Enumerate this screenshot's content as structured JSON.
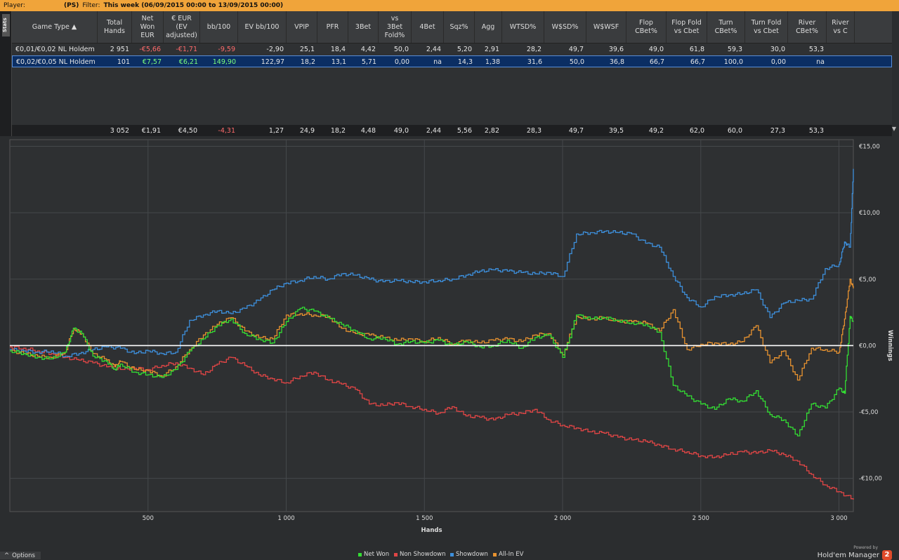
{
  "topbar": {
    "player_label": "Player:",
    "site_tag": "(PS)",
    "filter_label": "Filter:",
    "filter_value": "This week (06/09/2015 00:00 to 13/09/2015 00:00)"
  },
  "sidetab": {
    "label": "Stats"
  },
  "table": {
    "columns": [
      {
        "label": "Game Type ▲",
        "w": 122
      },
      {
        "label": "Total\nHands",
        "w": 49
      },
      {
        "label": "Net\nWon\nEUR",
        "w": 45
      },
      {
        "label": "€ EUR\n(EV\nadjusted)",
        "w": 52
      },
      {
        "label": "bb/100",
        "w": 54
      },
      {
        "label": "EV bb/100",
        "w": 69
      },
      {
        "label": "VPIP",
        "w": 44
      },
      {
        "label": "PFR",
        "w": 44
      },
      {
        "label": "3Bet",
        "w": 43
      },
      {
        "label": "vs\n3Bet\nFold%",
        "w": 47
      },
      {
        "label": "4Bet",
        "w": 46
      },
      {
        "label": "Sqz%",
        "w": 44
      },
      {
        "label": "Agg",
        "w": 39
      },
      {
        "label": "WTSD%",
        "w": 60
      },
      {
        "label": "W$SD%",
        "w": 60
      },
      {
        "label": "W$WSF",
        "w": 57
      },
      {
        "label": "Flop\nCBet%",
        "w": 57
      },
      {
        "label": "Flop Fold\nvs Cbet",
        "w": 58
      },
      {
        "label": "Turn\nCBet%",
        "w": 54
      },
      {
        "label": "Turn Fold\nvs Cbet",
        "w": 61
      },
      {
        "label": "River\nCBet%",
        "w": 55
      },
      {
        "label": "River\nvs C",
        "w": 40
      }
    ],
    "rows": [
      [
        "€0,01/€0,02 NL Holdem",
        "2 951",
        "-€5,66",
        "-€1,71",
        "-9,59",
        "-2,90",
        "25,1",
        "18,4",
        "4,42",
        "50,0",
        "2,44",
        "5,20",
        "2,91",
        "28,2",
        "49,7",
        "39,6",
        "49,0",
        "61,8",
        "59,3",
        "30,0",
        "53,3",
        ""
      ],
      [
        "€0,02/€0,05 NL Holdem",
        "101",
        "€7,57",
        "€6,21",
        "149,90",
        "122,97",
        "18,2",
        "13,1",
        "5,71",
        "0,00",
        "na",
        "14,3",
        "1,38",
        "31,6",
        "50,0",
        "36,8",
        "66,7",
        "66,7",
        "100,0",
        "0,00",
        "na",
        ""
      ]
    ],
    "totals": [
      "",
      "3 052",
      "€1,91",
      "€4,50",
      "-4,31",
      "1,27",
      "24,9",
      "18,2",
      "4,48",
      "49,0",
      "2,44",
      "5,56",
      "2,82",
      "28,3",
      "49,7",
      "39,5",
      "49,2",
      "62,0",
      "60,0",
      "27,3",
      "53,3",
      ""
    ]
  },
  "chart_data": {
    "type": "line",
    "xlabel": "Hands",
    "ylabel": "Winnings",
    "xlim": [
      0,
      3052
    ],
    "ylim": [
      -12.5,
      15.5
    ],
    "x_ticks": [
      500,
      1000,
      1500,
      2000,
      2500,
      3000
    ],
    "x_tick_labels": [
      "500",
      "1 000",
      "1 500",
      "2 000",
      "2 500",
      "3 000"
    ],
    "y_ticks": [
      15,
      10,
      5,
      0,
      -5,
      -10
    ],
    "y_tick_labels": [
      "€15,00",
      "€10,00",
      "€5,00",
      "€0,00",
      "-€5,00",
      "-€10,00"
    ],
    "grid": true,
    "legend_position": "bottom",
    "series": [
      {
        "name": "Net Won",
        "color": "#33dd33",
        "x": [
          0,
          50,
          100,
          150,
          200,
          230,
          260,
          300,
          350,
          380,
          400,
          450,
          500,
          550,
          600,
          650,
          700,
          750,
          800,
          850,
          900,
          950,
          1000,
          1050,
          1100,
          1150,
          1200,
          1250,
          1300,
          1350,
          1400,
          1450,
          1500,
          1550,
          1600,
          1650,
          1700,
          1750,
          1800,
          1850,
          1900,
          1950,
          2000,
          2050,
          2100,
          2150,
          2200,
          2250,
          2300,
          2350,
          2400,
          2450,
          2500,
          2550,
          2600,
          2650,
          2700,
          2750,
          2800,
          2850,
          2900,
          2950,
          3000,
          3020,
          3040,
          3052
        ],
        "y": [
          -0.4,
          -0.6,
          -0.9,
          -1.0,
          -0.5,
          1.3,
          0.9,
          -0.8,
          -1.2,
          -1.8,
          -1.4,
          -2.0,
          -2.2,
          -2.4,
          -1.8,
          -0.4,
          0.5,
          1.5,
          2.0,
          0.9,
          0.5,
          0.2,
          1.8,
          2.8,
          2.6,
          2.1,
          1.6,
          1.1,
          0.5,
          0.6,
          0.1,
          0.3,
          0.2,
          0.4,
          0.0,
          0.3,
          -0.1,
          0.0,
          0.4,
          -0.2,
          0.6,
          0.8,
          -0.9,
          2.3,
          2.0,
          2.1,
          1.9,
          1.7,
          1.6,
          1.0,
          -3.0,
          -3.8,
          -4.4,
          -4.8,
          -4.0,
          -4.2,
          -3.4,
          -5.2,
          -5.6,
          -6.8,
          -4.4,
          -4.7,
          -3.2,
          -3.6,
          2.2,
          1.8
        ]
      },
      {
        "name": "Non Showdown",
        "color": "#e04545",
        "x": [
          0,
          50,
          100,
          150,
          200,
          250,
          300,
          350,
          400,
          450,
          500,
          550,
          600,
          650,
          700,
          750,
          800,
          850,
          900,
          950,
          1000,
          1050,
          1100,
          1150,
          1200,
          1250,
          1300,
          1350,
          1400,
          1450,
          1500,
          1550,
          1600,
          1650,
          1700,
          1750,
          1800,
          1850,
          1900,
          1950,
          2000,
          2050,
          2100,
          2150,
          2200,
          2250,
          2300,
          2350,
          2400,
          2450,
          2500,
          2550,
          2600,
          2650,
          2700,
          2750,
          2800,
          2850,
          2900,
          2950,
          3000,
          3052
        ],
        "y": [
          -0.1,
          -0.2,
          -0.4,
          -0.6,
          -0.9,
          -1.1,
          -1.3,
          -1.6,
          -1.8,
          -1.7,
          -1.8,
          -1.5,
          -1.3,
          -1.7,
          -2.2,
          -1.4,
          -0.9,
          -1.5,
          -2.2,
          -2.5,
          -2.8,
          -2.3,
          -2.0,
          -2.6,
          -2.9,
          -3.3,
          -4.4,
          -4.5,
          -4.3,
          -4.6,
          -4.8,
          -5.1,
          -4.6,
          -5.3,
          -5.4,
          -5.6,
          -5.2,
          -5.1,
          -4.8,
          -5.6,
          -6.0,
          -6.2,
          -6.5,
          -6.6,
          -6.9,
          -7.1,
          -7.2,
          -7.5,
          -7.8,
          -8.0,
          -8.3,
          -8.4,
          -8.2,
          -8.0,
          -8.1,
          -7.9,
          -8.2,
          -8.7,
          -9.7,
          -10.5,
          -11.0,
          -11.6
        ]
      },
      {
        "name": "Showdown",
        "color": "#3d8fdc",
        "x": [
          0,
          50,
          100,
          150,
          200,
          250,
          300,
          350,
          400,
          450,
          500,
          550,
          600,
          650,
          700,
          750,
          800,
          850,
          900,
          950,
          1000,
          1050,
          1100,
          1150,
          1200,
          1250,
          1300,
          1350,
          1400,
          1450,
          1500,
          1550,
          1600,
          1650,
          1700,
          1750,
          1800,
          1850,
          1900,
          1950,
          2000,
          2050,
          2100,
          2150,
          2200,
          2250,
          2300,
          2350,
          2400,
          2450,
          2500,
          2550,
          2600,
          2650,
          2700,
          2750,
          2800,
          2850,
          2900,
          2950,
          3000,
          3020,
          3040,
          3052
        ],
        "y": [
          -0.3,
          -0.4,
          -0.5,
          -0.4,
          -0.8,
          -0.6,
          -0.3,
          -0.1,
          -0.2,
          -0.6,
          -0.4,
          -0.6,
          -0.5,
          1.9,
          2.3,
          2.6,
          2.4,
          2.8,
          3.4,
          4.2,
          4.7,
          4.9,
          5.2,
          5.0,
          5.4,
          5.3,
          5.0,
          4.8,
          4.9,
          4.8,
          4.8,
          4.9,
          5.0,
          5.3,
          5.6,
          5.7,
          5.6,
          5.5,
          5.4,
          5.5,
          5.2,
          8.4,
          8.5,
          8.6,
          8.5,
          8.4,
          7.7,
          7.4,
          5.2,
          3.6,
          2.9,
          3.7,
          3.8,
          3.9,
          4.2,
          2.1,
          3.2,
          3.4,
          3.5,
          5.8,
          6.1,
          7.8,
          7.4,
          13.3
        ]
      },
      {
        "name": "All-In EV",
        "color": "#e8922f",
        "x": [
          0,
          50,
          100,
          150,
          200,
          230,
          260,
          300,
          350,
          380,
          400,
          450,
          500,
          550,
          600,
          650,
          700,
          750,
          800,
          850,
          900,
          950,
          1000,
          1050,
          1100,
          1150,
          1200,
          1250,
          1300,
          1350,
          1400,
          1450,
          1500,
          1550,
          1600,
          1650,
          1700,
          1750,
          1800,
          1850,
          1900,
          1950,
          2000,
          2050,
          2100,
          2150,
          2200,
          2250,
          2300,
          2350,
          2400,
          2450,
          2500,
          2550,
          2600,
          2650,
          2700,
          2750,
          2800,
          2850,
          2900,
          2950,
          3000,
          3020,
          3040,
          3052
        ],
        "y": [
          -0.4,
          -0.6,
          -0.8,
          -0.9,
          -0.5,
          1.3,
          0.9,
          -0.6,
          -1.1,
          -1.6,
          -1.2,
          -1.8,
          -1.9,
          -2.3,
          -1.6,
          -0.3,
          0.8,
          1.6,
          2.1,
          1.1,
          0.6,
          0.5,
          2.3,
          2.4,
          2.3,
          2.2,
          1.3,
          0.9,
          0.8,
          0.6,
          0.4,
          0.5,
          0.3,
          0.6,
          0.1,
          0.4,
          0.2,
          0.4,
          0.5,
          0.3,
          0.8,
          0.9,
          -0.7,
          2.2,
          2.0,
          2.1,
          1.8,
          1.8,
          1.7,
          1.1,
          2.7,
          -0.3,
          0.1,
          0.2,
          0.1,
          0.3,
          1.5,
          -1.3,
          -0.4,
          -2.6,
          -0.2,
          -0.3,
          -0.5,
          2.0,
          5.0,
          4.3
        ]
      }
    ]
  },
  "legend": [
    "Net Won",
    "Non Showdown",
    "Showdown",
    "All-In EV"
  ],
  "footer": {
    "options": "Options",
    "powered_by": "Powered by",
    "brand": "Hold'em Manager",
    "badge": "2"
  }
}
